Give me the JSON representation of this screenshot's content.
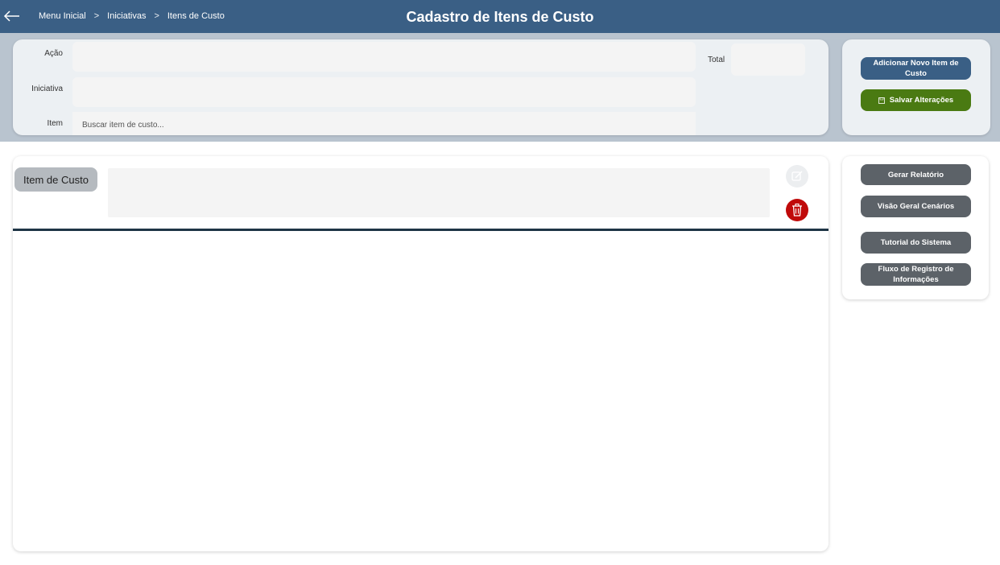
{
  "header": {
    "title": "Cadastro de Itens de Custo",
    "breadcrumb": [
      "Menu Inicial",
      "Iniciativas",
      "Itens de Custo"
    ]
  },
  "form": {
    "acao_label": "Ação",
    "iniciativa_label": "Iniciativa",
    "item_label": "Item",
    "item_placeholder": "Buscar item de custo...",
    "total_label": "Total"
  },
  "actions": {
    "add_label": "Adicionar Novo Item de Custo",
    "save_label": "Salvar Alterações"
  },
  "main": {
    "item_chip_label": "Item de Custo"
  },
  "side": {
    "report_label": "Gerar Relatório",
    "scenarios_label": "Visão Geral Cenários",
    "tutorial_label": "Tutorial do Sistema",
    "flow_label": "Fluxo de Registro de Informações"
  },
  "colors": {
    "header": "#3a5f85",
    "save_button": "#4a7a12",
    "delete": "#c00a0a",
    "gray_button": "#5c6268"
  },
  "icons": [
    "back-arrow-icon",
    "chevron-right-icon",
    "save-icon",
    "edit-icon",
    "trash-icon"
  ]
}
